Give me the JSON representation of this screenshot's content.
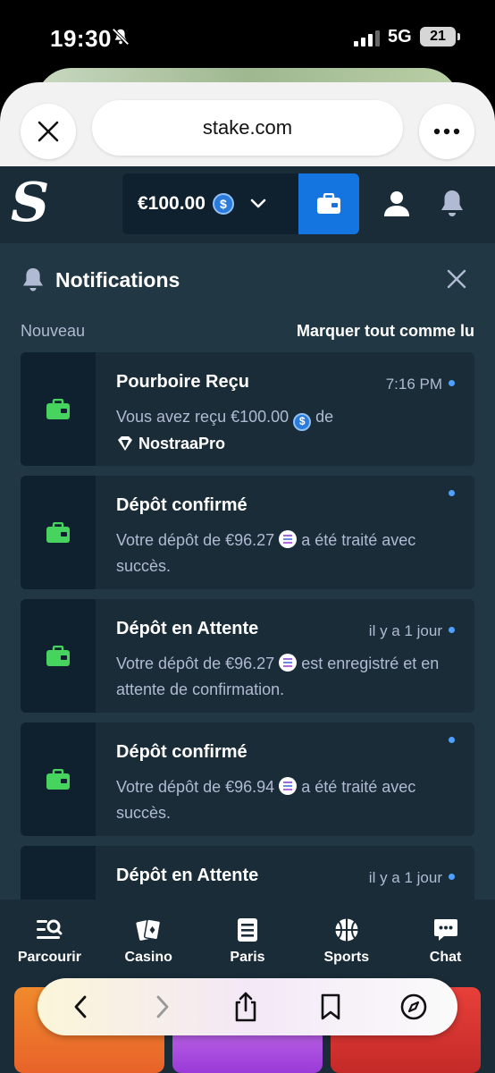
{
  "status_bar": {
    "time": "19:30",
    "network": "5G",
    "battery": "21"
  },
  "browser": {
    "url": "stake.com"
  },
  "header": {
    "balance": "€100.00",
    "coin_symbol": "$"
  },
  "notifications": {
    "title": "Notifications",
    "new_label": "Nouveau",
    "mark_all_label": "Marquer tout comme lu",
    "items": [
      {
        "title": "Pourboire Reçu",
        "time": "7:16 PM",
        "text_before": "Vous avez reçu €100.00",
        "text_after": "de",
        "user": "NostraaPro"
      },
      {
        "title": "Dépôt confirmé",
        "time": "",
        "text_before": "Votre dépôt de €96.27",
        "text_after": "a été traité avec succès."
      },
      {
        "title": "Dépôt en Attente",
        "time": "il y a 1 jour",
        "text_before": "Votre dépôt de €96.27",
        "text_after": "est enregistré et en attente de confirmation."
      },
      {
        "title": "Dépôt confirmé",
        "time": "",
        "text_before": "Votre dépôt de €96.94",
        "text_after": "a été traité avec succès."
      },
      {
        "title": "Dépôt en Attente",
        "time": "il y a 1 jour"
      }
    ]
  },
  "bottom_nav": {
    "items": [
      {
        "label": "Parcourir",
        "icon": "browse-icon"
      },
      {
        "label": "Casino",
        "icon": "cards-icon"
      },
      {
        "label": "Paris",
        "icon": "betslip-icon"
      },
      {
        "label": "Sports",
        "icon": "basketball-icon"
      },
      {
        "label": "Chat",
        "icon": "chat-icon"
      }
    ]
  },
  "colors": {
    "bg": "#213743",
    "card": "#1a2c38",
    "accent_blue": "#1475e1",
    "wallet_green": "#46d35e",
    "unread_dot": "#4fa0ff"
  }
}
